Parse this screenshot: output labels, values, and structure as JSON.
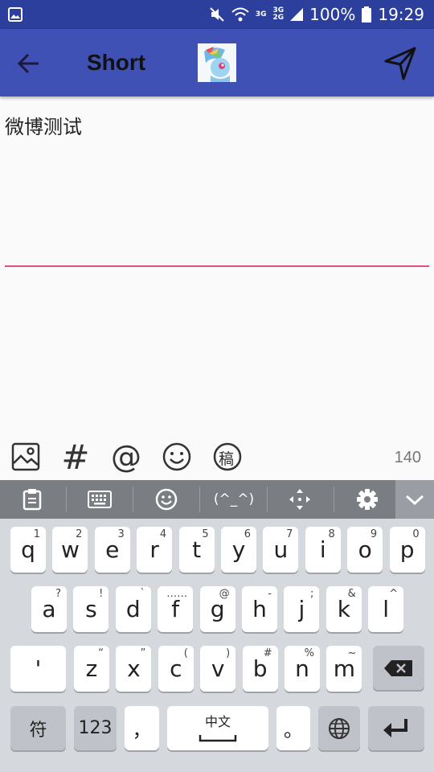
{
  "status_bar": {
    "battery": "100%",
    "time": "19:29",
    "net_top": "3G",
    "net_bottom": "2G"
  },
  "toolbar": {
    "back_icon": "arrow-left-icon",
    "title": "Short",
    "send_icon": "send-icon"
  },
  "editor": {
    "text": "微博测试"
  },
  "tools": {
    "items": [
      "image-icon",
      "hashtag-icon",
      "mention-icon",
      "emoji-icon",
      "draft-icon"
    ],
    "hashtag": "#",
    "mention": "@",
    "draft": "稿",
    "counter": "140"
  },
  "keyboard_bar": {
    "emoticon": "(^_^)"
  },
  "keyboard": {
    "row1": [
      {
        "k": "q",
        "h": "1"
      },
      {
        "k": "w",
        "h": "2"
      },
      {
        "k": "e",
        "h": "3"
      },
      {
        "k": "r",
        "h": "4"
      },
      {
        "k": "t",
        "h": "5"
      },
      {
        "k": "y",
        "h": "6"
      },
      {
        "k": "u",
        "h": "7"
      },
      {
        "k": "i",
        "h": "8"
      },
      {
        "k": "o",
        "h": "9"
      },
      {
        "k": "p",
        "h": "0"
      }
    ],
    "row2": [
      {
        "k": "a",
        "h": "?"
      },
      {
        "k": "s",
        "h": "!"
      },
      {
        "k": "d",
        "h": "`"
      },
      {
        "k": "f",
        "h": "……"
      },
      {
        "k": "g",
        "h": "@"
      },
      {
        "k": "h",
        "h": "-"
      },
      {
        "k": "j",
        "h": ";"
      },
      {
        "k": "k",
        "h": "&"
      },
      {
        "k": "l",
        "h": "^"
      }
    ],
    "row3": [
      {
        "k": "'",
        "h": ""
      },
      {
        "k": "z",
        "h": "“"
      },
      {
        "k": "x",
        "h": "”"
      },
      {
        "k": "c",
        "h": "("
      },
      {
        "k": "v",
        "h": ")"
      },
      {
        "k": "b",
        "h": "#"
      },
      {
        "k": "n",
        "h": "%"
      },
      {
        "k": "m",
        "h": "~"
      }
    ],
    "symbols": "符",
    "numbers": "123",
    "comma": "，",
    "space": "中文",
    "period": "。"
  }
}
